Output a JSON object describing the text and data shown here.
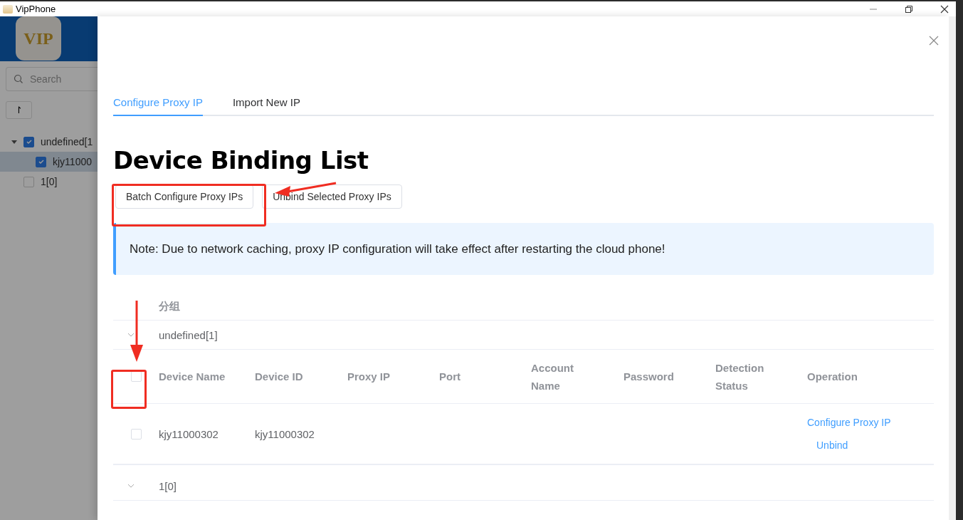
{
  "window": {
    "title": "VipPhone"
  },
  "sidebar": {
    "logo_text": "VIP",
    "search": {
      "placeholder": "Search"
    },
    "sort_button": "↾",
    "tree": [
      {
        "label": "undefined[1",
        "checked": true,
        "expanded": true,
        "selected": false,
        "children": [
          {
            "label": "kjy11000",
            "checked": true,
            "selected": true
          }
        ]
      },
      {
        "label": "1[0]",
        "checked": false,
        "selected": false
      }
    ]
  },
  "drawer": {
    "tabs": [
      {
        "label": "Configure Proxy IP",
        "selected": true
      },
      {
        "label": "Import New IP",
        "selected": false
      }
    ],
    "title": "Device Binding List",
    "buttons": [
      "Batch Configure Proxy IPs",
      "Unbind Selected Proxy IPs"
    ],
    "note": "Note: Due to network caching, proxy IP configuration will take effect after restarting the cloud phone!",
    "table": {
      "group_header": "分组",
      "groups": [
        {
          "label": "undefined[1]",
          "expanded": true,
          "header_checked": false,
          "columns": [
            "Device Name",
            "Device ID",
            "Proxy IP",
            "Port",
            "Account Name",
            "Password",
            "Detection Status",
            "Operation"
          ],
          "rows": [
            {
              "checked": false,
              "cells": [
                "kjy11000302",
                "kjy11000302"
              ],
              "actions": [
                "Configure Proxy IP",
                "Unbind"
              ]
            }
          ]
        },
        {
          "label": "1[0]",
          "expanded": true
        }
      ]
    }
  }
}
